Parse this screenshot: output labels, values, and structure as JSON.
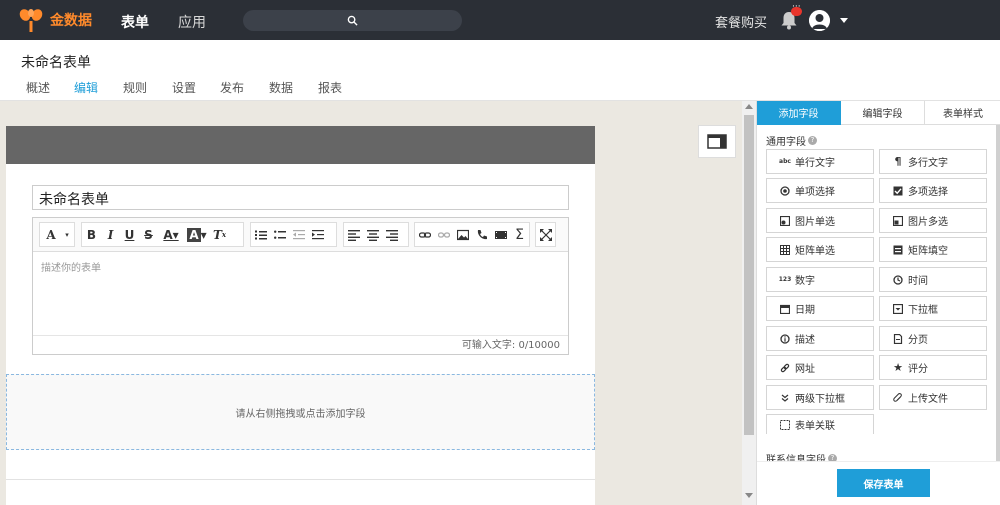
{
  "topbar": {
    "brand": "金数据",
    "nav": [
      "表单",
      "应用"
    ],
    "buy": "套餐购买"
  },
  "header": {
    "form_title": "未命名表单",
    "tabs": [
      "概述",
      "编辑",
      "规则",
      "设置",
      "发布",
      "数据",
      "报表"
    ],
    "active_tab": "编辑"
  },
  "editor": {
    "title_value": "未命名表单",
    "description_placeholder": "描述你的表单",
    "char_counter": "可输入文字: 0/10000",
    "dropzone_text": "请从右侧拖拽或点击添加字段"
  },
  "panel": {
    "tabs": [
      "添加字段",
      "编辑字段",
      "表单样式"
    ],
    "section_common": "通用字段",
    "section_contact": "联系信息字段",
    "fields": [
      {
        "label": "单行文字",
        "icon": "abc"
      },
      {
        "label": "多行文字",
        "icon": "¶"
      },
      {
        "label": "单项选择",
        "icon": "radio-icon"
      },
      {
        "label": "多项选择",
        "icon": "checkbox-icon"
      },
      {
        "label": "图片单选",
        "icon": "image-radio-icon"
      },
      {
        "label": "图片多选",
        "icon": "image-check-icon"
      },
      {
        "label": "矩阵单选",
        "icon": "matrix-icon"
      },
      {
        "label": "矩阵填空",
        "icon": "matrix-fill-icon"
      },
      {
        "label": "数字",
        "icon": "123"
      },
      {
        "label": "时间",
        "icon": "clock-icon"
      },
      {
        "label": "日期",
        "icon": "calendar-icon"
      },
      {
        "label": "下拉框",
        "icon": "dropdown-icon"
      },
      {
        "label": "描述",
        "icon": "info-icon"
      },
      {
        "label": "分页",
        "icon": "page-icon"
      },
      {
        "label": "网址",
        "icon": "link-icon"
      },
      {
        "label": "评分",
        "icon": "star-icon"
      },
      {
        "label": "两级下拉框",
        "icon": "double-chevron-icon"
      },
      {
        "label": "上传文件",
        "icon": "paperclip-icon"
      },
      {
        "label": "表单关联",
        "icon": "relation-icon"
      }
    ],
    "save_label": "保存表单"
  },
  "colors": {
    "accent": "#1f9ed8",
    "brand": "#ff8a2b",
    "topbar": "#2b2f36"
  }
}
